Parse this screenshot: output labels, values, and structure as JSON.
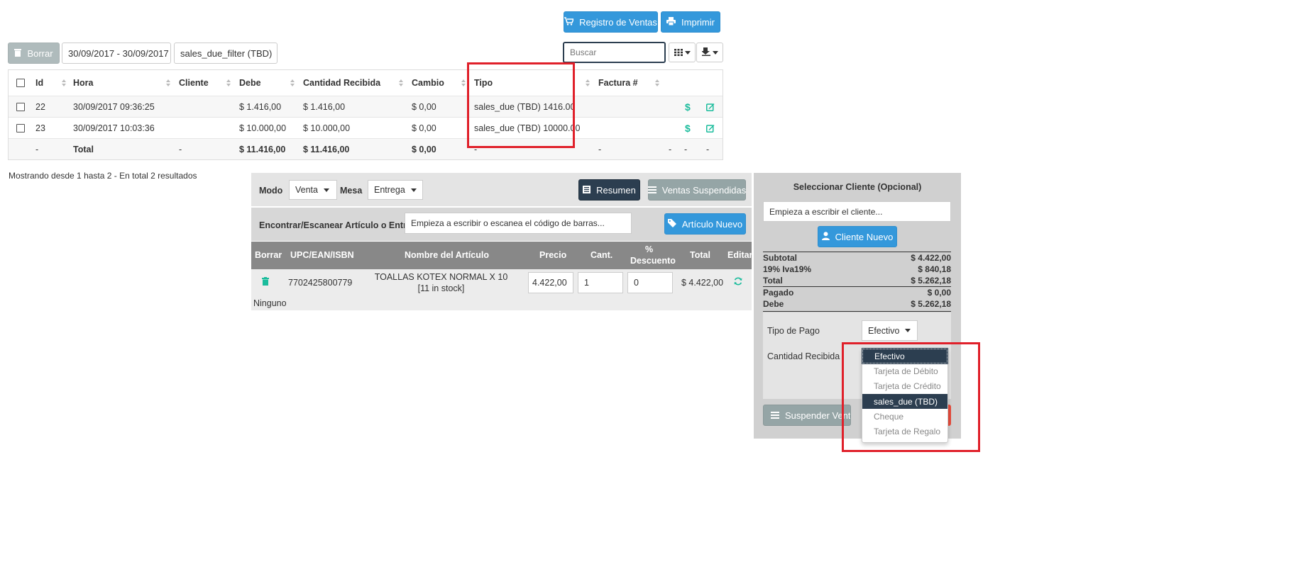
{
  "top_buttons": {
    "sales_register": "Registro de Ventas",
    "print": "Imprimir"
  },
  "toolbar": {
    "delete_label": "Borrar",
    "date_range": "30/09/2017 - 30/09/2017",
    "filter_value": "sales_due_filter (TBD)",
    "search_placeholder": "Buscar"
  },
  "table": {
    "headers": [
      "Id",
      "Hora",
      "Cliente",
      "Debe",
      "Cantidad Recibida",
      "Cambio",
      "Tipo",
      "Factura #"
    ],
    "rows": [
      {
        "id": "22",
        "time": "30/09/2017 09:36:25",
        "client": "",
        "due": "$ 1.416,00",
        "received": "$ 1.416,00",
        "change": "$ 0,00",
        "type": "sales_due (TBD) 1416.00",
        "invoice": ""
      },
      {
        "id": "23",
        "time": "30/09/2017 10:03:36",
        "client": "",
        "due": "$ 10.000,00",
        "received": "$ 10.000,00",
        "change": "$ 0,00",
        "type": "sales_due (TBD) 10000.00",
        "invoice": ""
      }
    ],
    "footer": {
      "id": "-",
      "label": "Total",
      "client": "-",
      "due": "$ 11.416,00",
      "received": "$ 11.416,00",
      "change": "$ 0,00",
      "type": "-",
      "invoice": "-",
      "d1": "-",
      "d2": "-",
      "d3": "-"
    },
    "pagination_text": "Mostrando desde 1 hasta 2 - En total 2 resultados"
  },
  "register": {
    "mode_label": "Modo",
    "mode_value": "Venta",
    "table_label": "Mesa",
    "table_value": "Entrega",
    "summary_button": "Resumen",
    "suspended_button": "Ventas Suspendidas",
    "find_label": "Encontrar/Escanear Artículo o Entrada",
    "find_placeholder": "Empieza a escribir o escanea el código de barras...",
    "new_item_button": "Artículo Nuevo",
    "cart_headers": {
      "delete": "Borrar",
      "upc": "UPC/EAN/ISBN",
      "name": "Nombre del Artículo",
      "price": "Precio",
      "qty": "Cant.",
      "discount_1": "%",
      "discount_2": "Descuento",
      "total": "Total",
      "edit": "Editar"
    },
    "cart_item": {
      "upc": "7702425800779",
      "name": "TOALLAS KOTEX NORMAL X 10",
      "stock": "[11 in stock]",
      "price": "4.422,00",
      "qty": "1",
      "discount": "0",
      "total": "$ 4.422,00"
    },
    "cart_note": "Ninguno"
  },
  "customer": {
    "title": "Seleccionar Cliente (Opcional)",
    "placeholder": "Empieza a escribir el cliente...",
    "new_customer_button": "Cliente Nuevo"
  },
  "totals": [
    {
      "label": "Subtotal",
      "value": "$ 4.422,00"
    },
    {
      "label": "19% Iva19%",
      "value": "$ 840,18"
    },
    {
      "label": "Total",
      "value": "$ 5.262,18"
    },
    {
      "label": "Pagado",
      "value": "$ 0,00"
    },
    {
      "label": "Debe",
      "value": "$ 5.262,18"
    }
  ],
  "payment": {
    "type_label": "Tipo de Pago",
    "type_value": "Efectivo",
    "amount_label": "Cantidad Recibida",
    "options": [
      "Efectivo",
      "Tarjeta de Débito",
      "Tarjeta de Crédito",
      "sales_due (TBD)",
      "Cheque",
      "Tarjeta de Regalo"
    ],
    "suspend_button": "Suspender Venta"
  },
  "colors": {
    "primary": "#3498db",
    "dark": "#2c3e50",
    "gray_button": "#95a5a6",
    "success_icon": "#1abc9c",
    "highlight_box": "#e0202a"
  },
  "icons": [
    "cart-icon",
    "print-icon",
    "trash-icon",
    "grid-icon",
    "export-icon",
    "dollar-icon",
    "edit-icon",
    "list-icon",
    "tag-icon",
    "user-icon",
    "refresh-icon"
  ]
}
